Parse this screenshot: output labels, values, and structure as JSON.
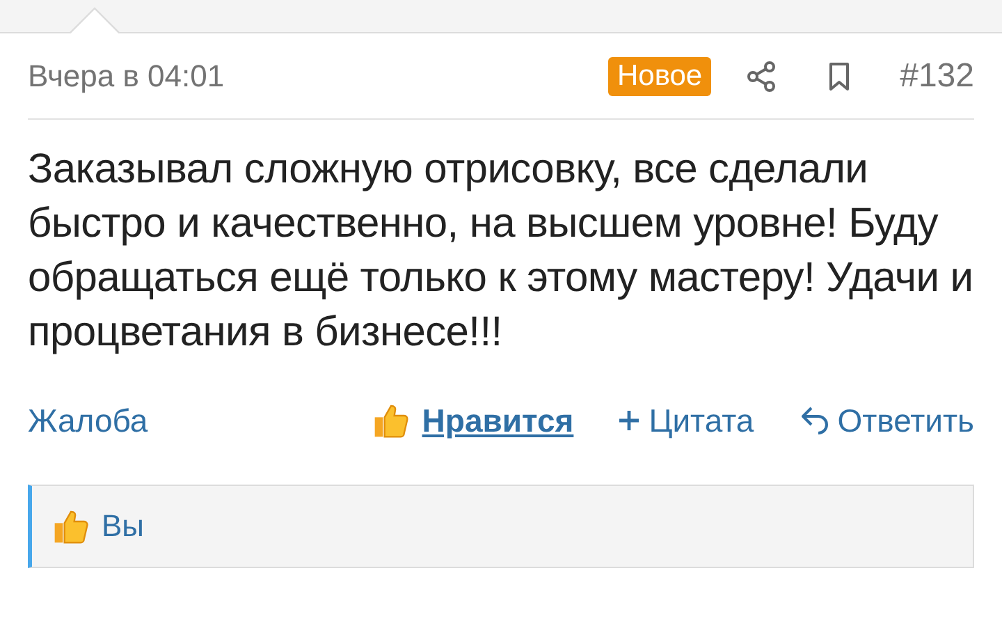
{
  "post": {
    "date": "Вчера в 04:01",
    "badge": "Новое",
    "number": "#132",
    "message": "Заказывал сложную отрисовку, все сделали быстро и качественно, на высшем уровне! Буду обращаться ещё только к этому мастеру! Удачи и процветания в бизнесе!!!",
    "actions": [
      {
        "kind": "report",
        "label": "Жалоба"
      },
      {
        "kind": "like",
        "label": "Нравится",
        "selected": true
      },
      {
        "kind": "quote",
        "label": "Цитата"
      },
      {
        "kind": "reply",
        "label": "Ответить"
      }
    ],
    "likes": {
      "text": "Вы"
    }
  }
}
